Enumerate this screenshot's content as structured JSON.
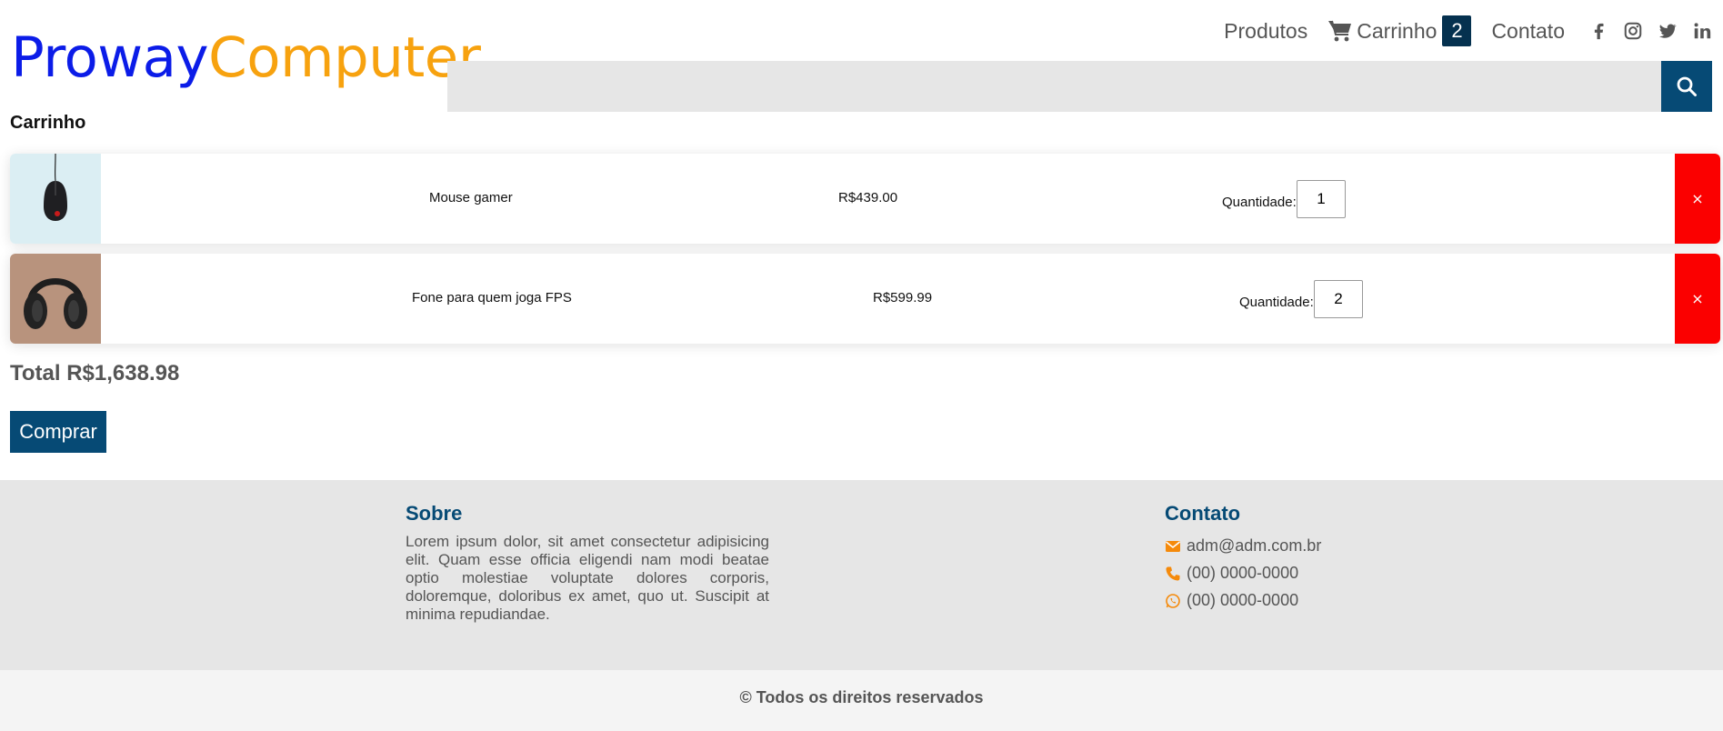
{
  "header": {
    "logo_part1": "Proway",
    "logo_part2": "Computer",
    "nav_products": "Produtos",
    "nav_cart": "Carrinho",
    "cart_count": "2",
    "nav_contact": "Contato",
    "social": [
      "facebook-icon",
      "instagram-icon",
      "twitter-icon",
      "linkedin-icon"
    ],
    "search_placeholder": ""
  },
  "cart": {
    "heading": "Carrinho",
    "qty_label": "Quantidade:",
    "remove_label": "×",
    "items": [
      {
        "name": "Mouse gamer",
        "price": "R$439.00",
        "quantity": "1"
      },
      {
        "name": "Fone para quem joga FPS",
        "price": "R$599.99",
        "quantity": "2"
      }
    ],
    "total": "Total R$1,638.98",
    "buy_label": "Comprar"
  },
  "footer": {
    "about_title": "Sobre",
    "about_text": "Lorem ipsum dolor, sit amet consectetur adipisicing elit. Quam esse officia eligendi nam modi beatae optio molestiae voluptate dolores corporis, doloremque, doloribus ex amet, quo ut. Suscipit at minima repudiandae.",
    "contact_title": "Contato",
    "email": "adm@adm.com.br",
    "phone": "(00) 0000-0000",
    "whatsapp": "(00) 0000-0000",
    "copyright": "© Todos os direitos reservados"
  },
  "colors": {
    "logo_blue": "#0b1ce8",
    "logo_orange": "#f7a20f",
    "primary": "#064a75",
    "remove_red": "#fb0000",
    "contact_icon_orange": "#f58a0b"
  }
}
